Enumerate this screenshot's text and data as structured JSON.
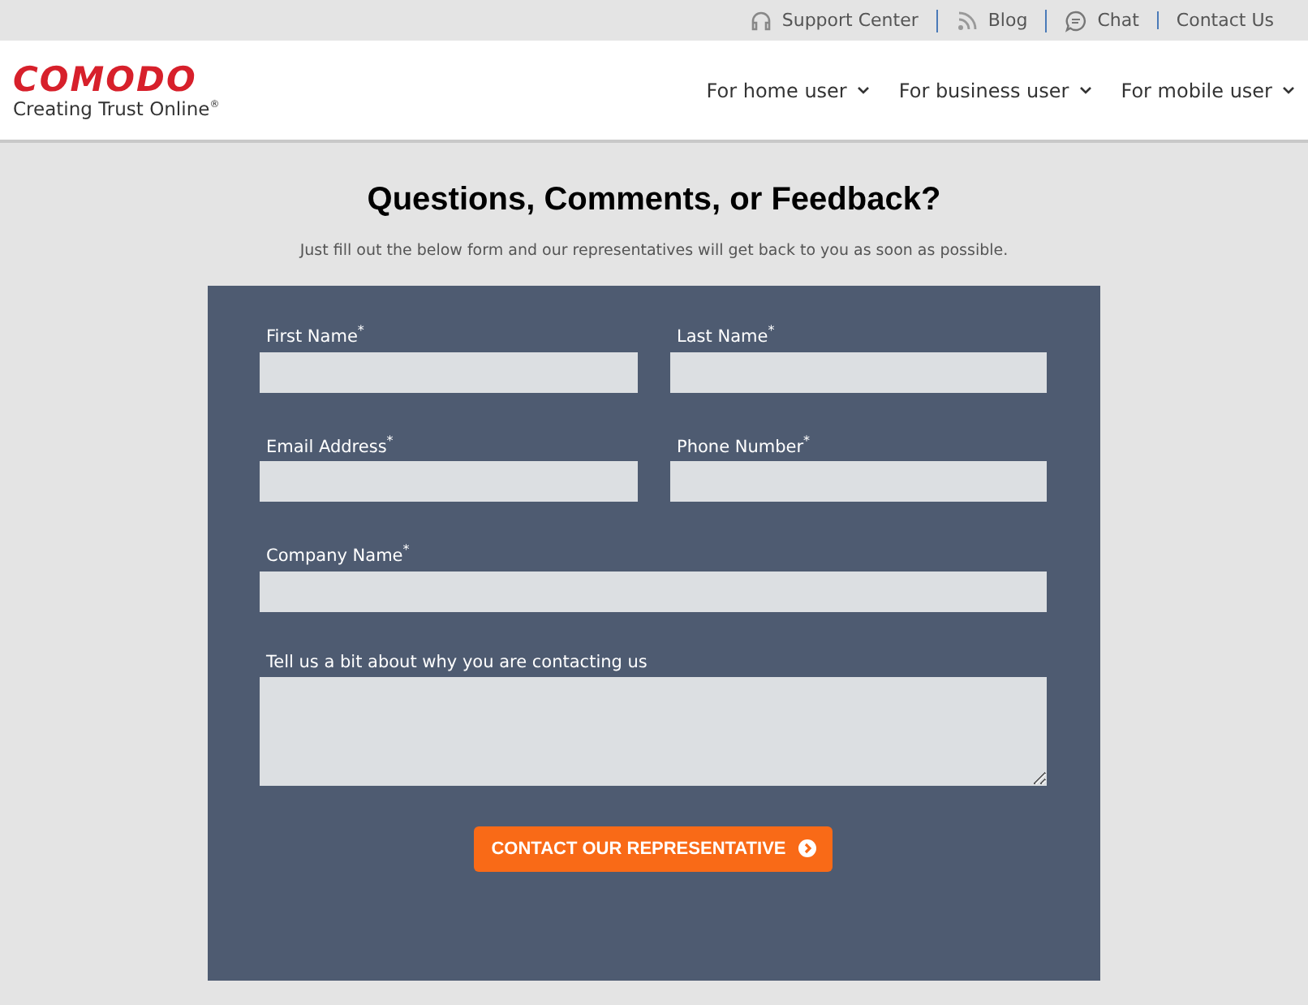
{
  "top_links": [
    {
      "label": "Support Center",
      "kind": "support"
    },
    {
      "label": "Blog",
      "kind": "blog"
    },
    {
      "label": "Chat",
      "kind": "chat"
    },
    {
      "label": "Contact Us",
      "kind": "contact"
    }
  ],
  "logo": {
    "name": "COMODO",
    "tagline": "Creating Trust Online$^{®}$"
  },
  "nav": [
    {
      "label": "For home user"
    },
    {
      "label": "For business user"
    },
    {
      "label": "For mobile user"
    }
  ],
  "title": "Questions, Comments, or Feedback?",
  "subtitle": "Just fill out the below form and our representatives will get back to you as soon as possible.",
  "fields": [
    {
      "label": "First Name",
      "mark": "*",
      "kind": "half"
    },
    {
      "label": "Last Name",
      "mark": "*",
      "kind": "half"
    },
    {
      "label": "Email Address",
      "mark": "*",
      "kind": "half"
    },
    {
      "label": "Phone Number",
      "mark": "*",
      "kind": "half"
    },
    {
      "label": "Company Name",
      "mark": "*",
      "kind": "full"
    },
    {
      "label": "Tell us a bit about why you are contacting us",
      "kind": "textarea"
    }
  ],
  "submit": {
    "label": "CONTACT OUR REPRESENTATIVE"
  }
}
